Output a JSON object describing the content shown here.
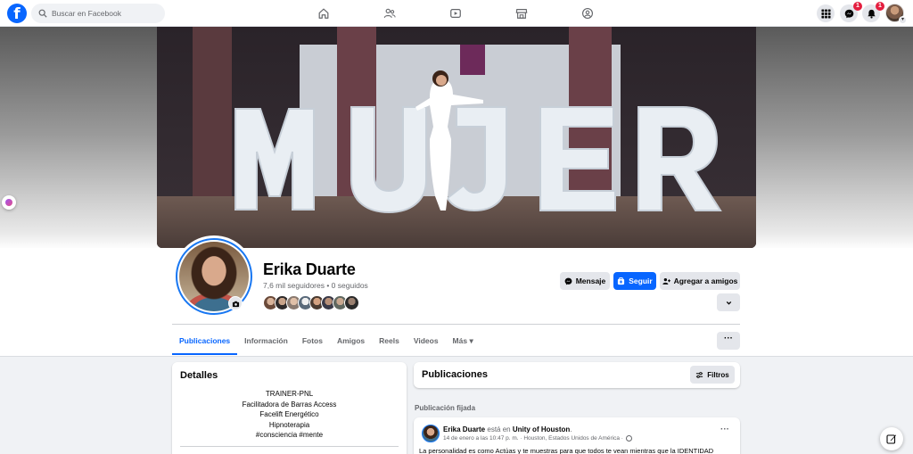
{
  "nav": {
    "search_placeholder": "Buscar en Facebook",
    "messenger_badge": "1",
    "notifications_badge": "1",
    "brand_color": "#0866ff"
  },
  "profile": {
    "name": "Erika Duarte",
    "stats": "7,6 mil seguidores • 0 seguidos",
    "cover_letters": "MUJER"
  },
  "actions": {
    "message": "Mensaje",
    "follow": "Seguir",
    "add_friend": "Agregar a amigos"
  },
  "tabs": [
    {
      "label": "Publicaciones",
      "active": true
    },
    {
      "label": "Información"
    },
    {
      "label": "Fotos"
    },
    {
      "label": "Amigos"
    },
    {
      "label": "Reels"
    },
    {
      "label": "Videos"
    },
    {
      "label": "Más ▾"
    }
  ],
  "details": {
    "title": "Detalles",
    "bio": [
      "TRAINER-PNL",
      "Facilitadora de Barras Access",
      "Facelift Energético",
      "Hipnoterapia",
      "#consciencia #mente"
    ]
  },
  "posts": {
    "title": "Publicaciones",
    "filter": "Filtros",
    "pinned_label": "Publicación fijada",
    "pinned_post": {
      "author": "Erika Duarte",
      "verb": " está en ",
      "place": "Unity of Houston",
      "period": ".",
      "meta": "14 de enero a las 10:47 p. m. · Houston, Estados Unidos de América ·",
      "text": "La personalidad es como Actúas y te muestras para que todos te vean mientras que la IDENTIDAD"
    }
  },
  "icons": [
    "facebook-logo",
    "search-icon",
    "home-icon",
    "friends-icon",
    "video-icon",
    "marketplace-icon",
    "groups-icon",
    "menu-grid-icon",
    "messenger-icon",
    "bell-icon",
    "camera-icon",
    "follow-icon",
    "add-friend-icon",
    "chevron-down-icon",
    "more-icon",
    "filter-icon",
    "globe-icon",
    "compose-icon"
  ]
}
